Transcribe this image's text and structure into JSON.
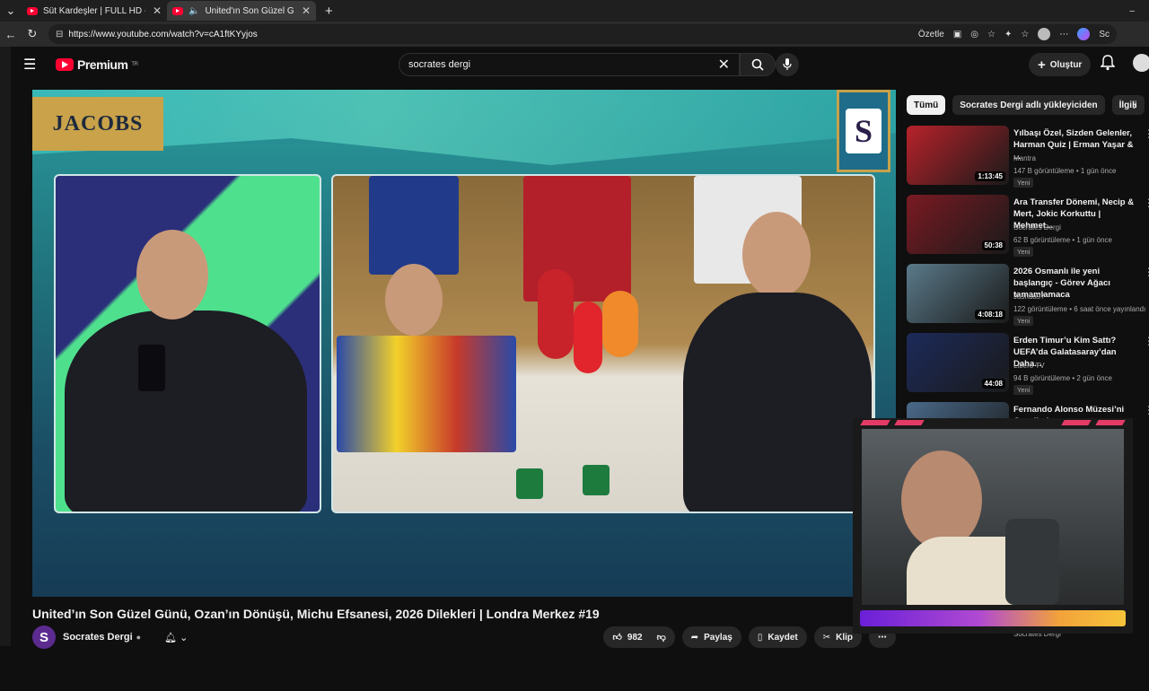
{
  "browser": {
    "tabs": [
      {
        "label": "Süt Kardeşler | FULL HD - YouTube",
        "active": false,
        "close": "✕"
      },
      {
        "label": "United'ın Son Güzel Günü, Oz...",
        "active": true,
        "close": "✕"
      }
    ],
    "new_tab": "+",
    "url": "https://www.youtube.com/watch?v=cA1ftKYyjos",
    "summarize_label": "Özetle",
    "profile_label": "Sc"
  },
  "youtube": {
    "logo_text": "Premium",
    "logo_region": "TR",
    "search_value": "socrates dergi",
    "create_label": "Oluştur"
  },
  "video": {
    "sponsor": "JACOBS",
    "badge_letter": "S",
    "title": "United’ın Son Güzel Günü, Ozan’ın Dönüşü, Michu Efsanesi, 2026 Dilekleri | Londra Merkez #19",
    "channel_name": "Socrates Dergi",
    "channel_initial": "S",
    "likes": "982",
    "share_label": "Paylaş",
    "save_label": "Kaydet",
    "clip_label": "Klip"
  },
  "chips": [
    {
      "label": "Tümü",
      "active": true
    },
    {
      "label": "Socrates Dergi adlı yükleyiciden",
      "active": false
    },
    {
      "label": "İlgili",
      "active": false
    }
  ],
  "recommendations": [
    {
      "title": "Yılbaşı Özel, Sizden Gelenler, Harman Quiz | Erman Yaşar & ...",
      "channel": "Mantra",
      "meta": "147 B görüntüleme • 1 gün önce",
      "badge": "Yeni",
      "duration": "1:13:45",
      "thumb_color": "#b8222a"
    },
    {
      "title": "Ara Transfer Dönemi, Necip & Mert, Jokic Korkuttu | Mehmet...",
      "channel": "Socrates Dergi",
      "meta": "62 B görüntüleme • 1 gün önce",
      "badge": "Yeni",
      "duration": "50:38",
      "thumb_color": "#7a1a22"
    },
    {
      "title": "2026 Osmanlı ile yeni başlangıç - Görev Ağacı tamamlamaca",
      "channel": "Jashua97",
      "meta": "122 görüntüleme • 6 saat önce yayınlandı",
      "badge": "Yeni",
      "duration": "4:08:18",
      "thumb_color": "#5a7a8a"
    },
    {
      "title": "Erden Timur’u Kim Sattı? UEFA’da Galatasaray’dan Daha...",
      "channel": "Libero TV",
      "meta": "94 B görüntüleme • 2 gün önce",
      "badge": "Yeni",
      "duration": "44:08",
      "thumb_color": "#1c2a5a"
    },
    {
      "title": "Fernando Alonso Müzesi’ni Gezelim!",
      "channel": "",
      "meta": "",
      "badge": "",
      "duration": "",
      "thumb_color": "#4a6a8a"
    }
  ],
  "bottom_rec_channel": "Socrates Dergi"
}
